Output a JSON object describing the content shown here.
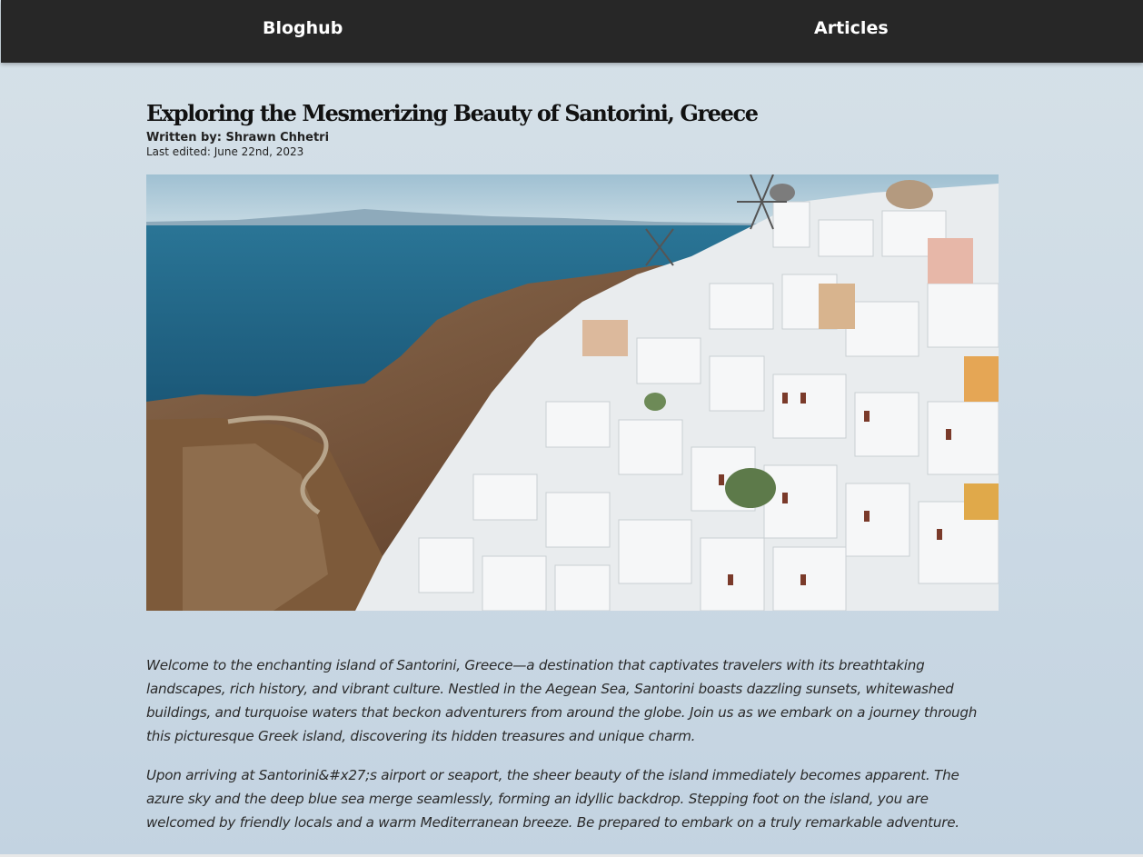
{
  "nav": {
    "brand": "Bloghub",
    "articles": "Articles"
  },
  "article": {
    "title": "Exploring the Mesmerizing Beauty of Santorini, Greece",
    "author": "Written by: Shrawn Chhetri",
    "last_edited": "Last edited: June 22nd, 2023",
    "paragraphs": [
      "Welcome to the enchanting island of Santorini, Greece—a destination that captivates travelers with its breathtaking landscapes, rich history, and vibrant culture. Nestled in the Aegean Sea, Santorini boasts dazzling sunsets, whitewashed buildings, and turquoise waters that beckon adventurers from around the globe. Join us as we embark on a journey through this picturesque Greek island, discovering its hidden treasures and unique charm.",
      "Upon arriving at Santorini&#x27;s airport or seaport, the sheer beauty of the island immediately becomes apparent. The azure sky and the deep blue sea merge seamlessly, forming an idyllic backdrop. Stepping foot on the island, you are welcomed by friendly locals and a warm Mediterranean breeze. Be prepared to embark on a truly remarkable adventure."
    ]
  },
  "colors": {
    "topbar": "#272727",
    "sea": "#1d5f80",
    "sky": "#a9c6d6"
  }
}
